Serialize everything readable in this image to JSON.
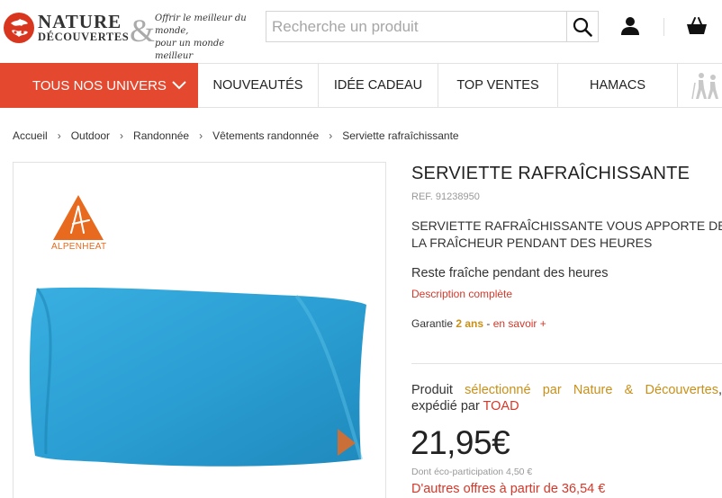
{
  "colors": {
    "brand_red": "#e4492f",
    "link_red": "#d4382a",
    "gold": "#c8901a",
    "towel_blue": "#2b9fd3",
    "alpenheat_orange": "#e76a1e"
  },
  "header": {
    "logo_line1": "NATURE",
    "logo_line2": "DÉCOUVERTES",
    "logo_amp": "&",
    "tagline_line1": "Offrir le meilleur du monde,",
    "tagline_line2": "pour un monde meilleur",
    "search_placeholder": "Recherche un produit",
    "icons": {
      "search": "search-icon",
      "account": "user-icon",
      "cart": "basket-icon"
    }
  },
  "nav": {
    "univers_label": "TOUS NOS UNIVERS",
    "items": [
      {
        "label": "NOUVEAUTÉS"
      },
      {
        "label": "IDÉE CADEAU"
      },
      {
        "label": "TOP VENTES"
      },
      {
        "label": "HAMACS"
      }
    ]
  },
  "breadcrumb": [
    "Accueil",
    "Outdoor",
    "Randonnée",
    "Vêtements randonnée",
    "Serviette rafraîchissante"
  ],
  "product": {
    "brand": "ALPENHEAT",
    "title": "SERVIETTE RAFRAÎCHISSANTE",
    "ref": "REF. 91238950",
    "headline": "SERVIETTE RAFRAÎCHISSANTE VOUS APPORTE DE LA FRAÎCHEUR PENDANT DES HEURES",
    "short_desc": "Reste fraîche pendant des heures",
    "full_desc_link": "Description complète",
    "guarantee_prefix": "Garantie ",
    "guarantee_value": "2 ans",
    "guarantee_sep": " - ",
    "guarantee_link": "en savoir +",
    "seller_prefix": "Produit ",
    "seller_mid": "sélectionné par Nature & Découvertes",
    "seller_mid2": ", expédié par ",
    "seller_name": "TOAD",
    "price": "21,95€",
    "eco": "Dont éco-participation 4,50 €",
    "other_offers": "D'autres offres à partir de 36,54 €"
  }
}
